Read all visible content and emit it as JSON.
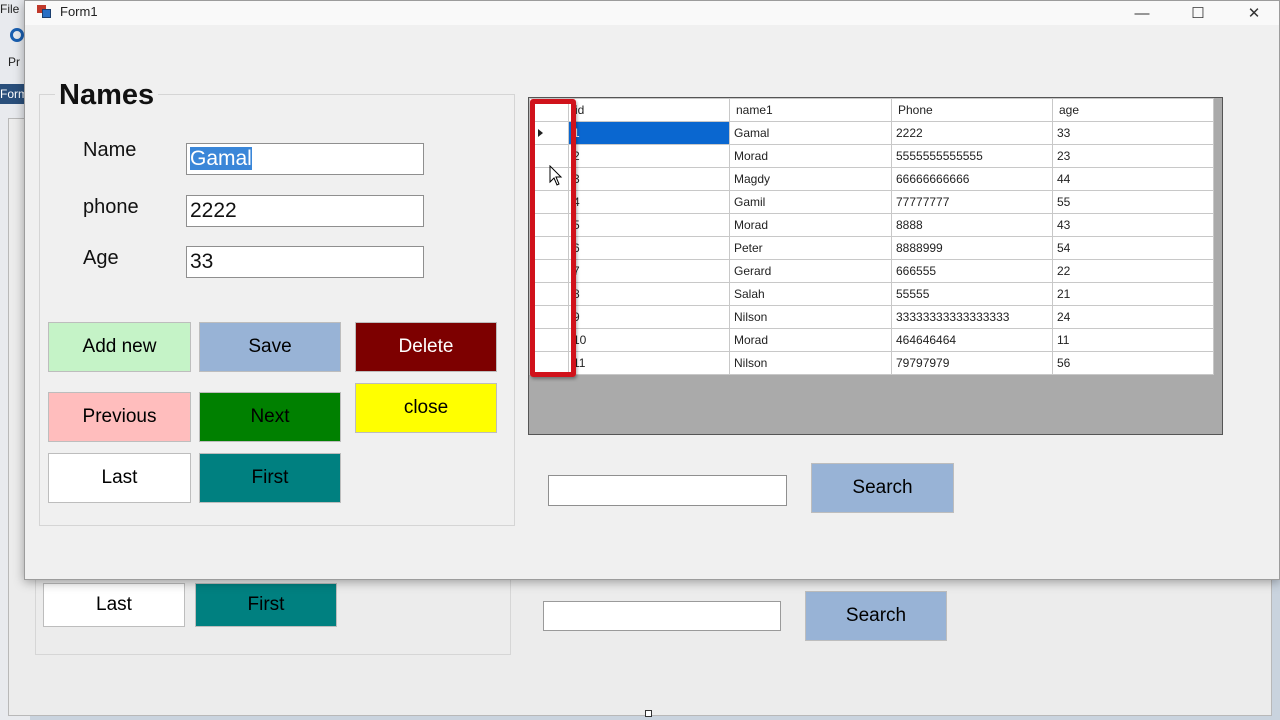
{
  "ide": {
    "menu_file": "File",
    "tool_label": "Pr",
    "tab_label": "Form1"
  },
  "designer": {
    "last_label": "Last",
    "first_label": "First",
    "search_label": "Search"
  },
  "window": {
    "title": "Form1",
    "minimize": "—",
    "maximize": "☐",
    "close": "✕"
  },
  "form": {
    "group_title": "Names",
    "name_label": "Name",
    "phone_label": "phone",
    "age_label": "Age",
    "name_value": "Gamal",
    "phone_value": "2222",
    "age_value": "33"
  },
  "buttons": {
    "add_new": "Add new",
    "save": "Save",
    "delete": "Delete",
    "previous": "Previous",
    "next": "Next",
    "close": "close",
    "last": "Last",
    "first": "First",
    "search": "Search"
  },
  "colors": {
    "add_new": "#c5f3c7",
    "save": "#98b3d6",
    "delete": "#7d0000",
    "previous": "#ffbdbd",
    "next": "#008000",
    "close": "#ffff00",
    "last": "#ffffff",
    "first": "#008080",
    "search": "#98b3d6",
    "grid_selection": "#0a67d0",
    "highlight": "#d0121b"
  },
  "grid": {
    "columns": [
      "id",
      "name1",
      "Phone",
      "age"
    ],
    "rows": [
      [
        "1",
        "Gamal",
        "2222",
        "33"
      ],
      [
        "2",
        "Morad",
        "5555555555555",
        "23"
      ],
      [
        "3",
        "Magdy",
        "66666666666",
        "44"
      ],
      [
        "4",
        "Gamil",
        "77777777",
        "55"
      ],
      [
        "5",
        "Morad",
        "8888",
        "43"
      ],
      [
        "6",
        "Peter",
        "8888999",
        "54"
      ],
      [
        "7",
        "Gerard",
        "666555",
        "22"
      ],
      [
        "8",
        "Salah",
        "55555",
        "21"
      ],
      [
        "9",
        "Nilson",
        "33333333333333333",
        "24"
      ],
      [
        "10",
        "Morad",
        "464646464",
        "11"
      ],
      [
        "11",
        "Nilson",
        "79797979",
        "56"
      ]
    ],
    "selected_row": 0
  },
  "search": {
    "value": ""
  }
}
